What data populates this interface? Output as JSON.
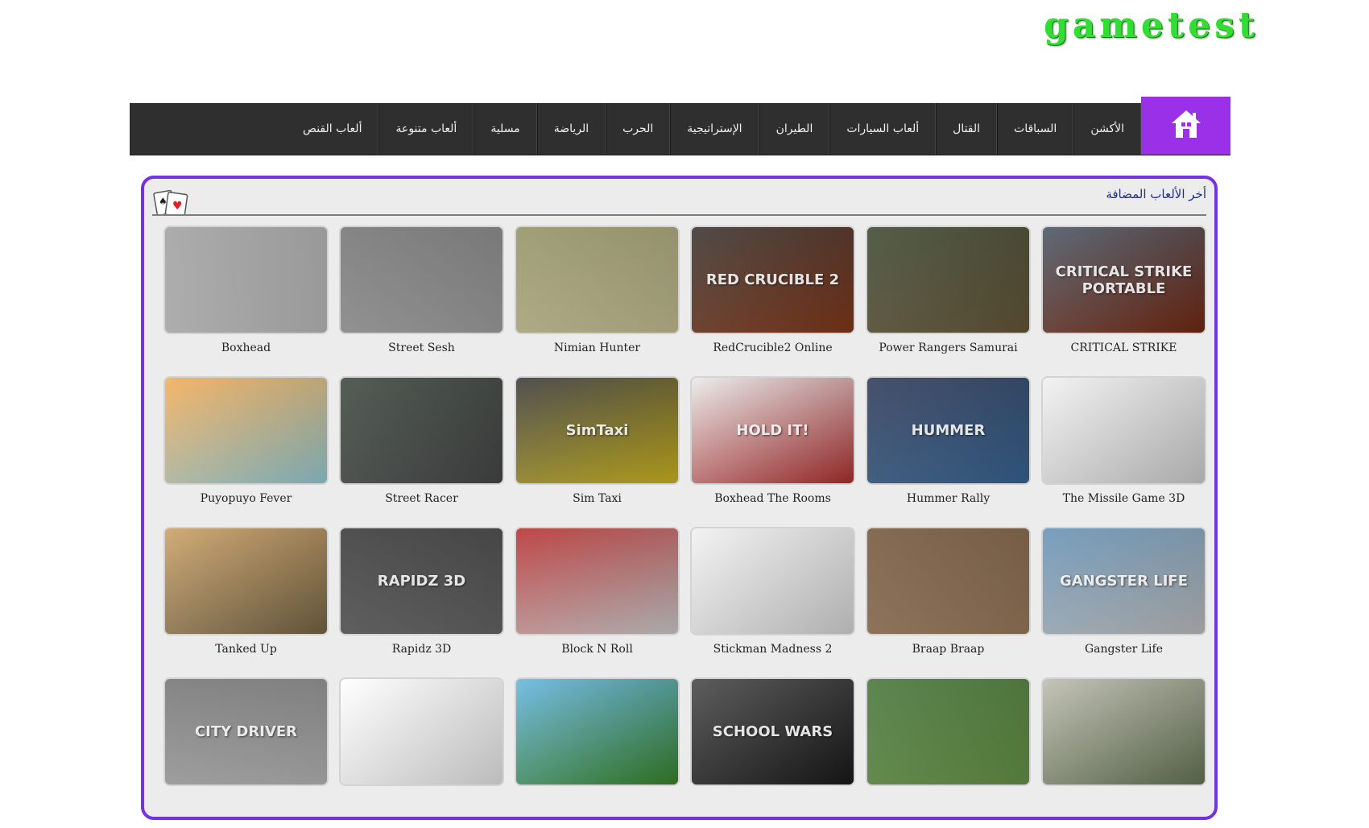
{
  "site": {
    "logo": "gametest"
  },
  "nav": {
    "home_icon": "home-icon",
    "items": [
      "الأكشن",
      "السباقات",
      "القتال",
      "ألعاب السيارات",
      "الطيران",
      "الإستراتيجية",
      "الحرب",
      "الرياضة",
      "مسلية",
      "ألعاب متنوعة",
      "ألعاب القنص"
    ]
  },
  "panel": {
    "title": "أخر الألعاب المضافة",
    "icon": "playing-cards-icon"
  },
  "games": [
    {
      "title": "CRITICAL STRIKE",
      "color": "#3b4a5a",
      "color2": "#7a2a12",
      "art": "CRITICAL STRIKE PORTABLE"
    },
    {
      "title": "Power Rangers Samurai",
      "color": "#2e3a22",
      "color2": "#6b5a3a",
      "art": ""
    },
    {
      "title": "RedCrucible2 Online",
      "color": "#2a231e",
      "color2": "#8a3a1a",
      "art": "RED CRUCIBLE 2"
    },
    {
      "title": "Nimian Hunter",
      "color": "#8a8a5a",
      "color2": "#cfc79a",
      "art": ""
    },
    {
      "title": "Street Sesh",
      "color": "#6a6a6a",
      "color2": "#a8a8a8",
      "art": ""
    },
    {
      "title": "Boxhead",
      "color": "#9a9a9a",
      "color2": "#c4c4c4",
      "art": ""
    },
    {
      "title": "The Missile Game 3D",
      "color": "#f0f0f0",
      "color2": "#d8d8d8",
      "art": ""
    },
    {
      "title": "Hummer Rally",
      "color": "#1e2a4a",
      "color2": "#3a6a9a",
      "art": "HUMMER"
    },
    {
      "title": "Boxhead The Rooms",
      "color": "#e8e8e8",
      "color2": "#b83030",
      "art": "HOLD IT!"
    },
    {
      "title": "Sim Taxi",
      "color": "#2a2a2a",
      "color2": "#d8c020",
      "art": "SimTaxi"
    },
    {
      "title": "Street Racer",
      "color": "#2e3a32",
      "color2": "#4a4a4a",
      "art": ""
    },
    {
      "title": "Puyopuyo Fever",
      "color": "#f3a64a",
      "color2": "#9dd6e0",
      "art": ""
    },
    {
      "title": "Gangster Life",
      "color": "#5a8ab0",
      "color2": "#c8c8c8",
      "art": "GANGSTER LIFE"
    },
    {
      "title": "Braap Braap",
      "color": "#6a4a2e",
      "color2": "#a08060",
      "art": ""
    },
    {
      "title": "Stickman Madness 2",
      "color": "#f0f0f0",
      "color2": "#e0e0e0",
      "art": ""
    },
    {
      "title": "Block N Roll",
      "color": "#b02020",
      "color2": "#d8d8d8",
      "art": ""
    },
    {
      "title": "Rapidz 3D",
      "color": "#2a2a2a",
      "color2": "#6a6a6a",
      "art": "RAPIDZ 3D"
    },
    {
      "title": "Tanked Up",
      "color": "#c89a5a",
      "color2": "#7a6a4a",
      "art": ""
    },
    {
      "title": "",
      "color": "#b8b8a8",
      "color2": "#6a7a5a",
      "art": ""
    },
    {
      "title": "",
      "color": "#3a6a2a",
      "color2": "#6a9a4a",
      "art": ""
    },
    {
      "title": "",
      "color": "#3a3a3a",
      "color2": "#1a1a1a",
      "art": "SCHOOL WARS"
    },
    {
      "title": "",
      "color": "#5ab0e0",
      "color2": "#3a8a2a",
      "art": ""
    },
    {
      "title": "",
      "color": "#ffffff",
      "color2": "#f0f0f0",
      "art": ""
    },
    {
      "title": "",
      "color": "#6a6a6a",
      "color2": "#c0c0c0",
      "art": "CITY DRIVER"
    }
  ]
}
